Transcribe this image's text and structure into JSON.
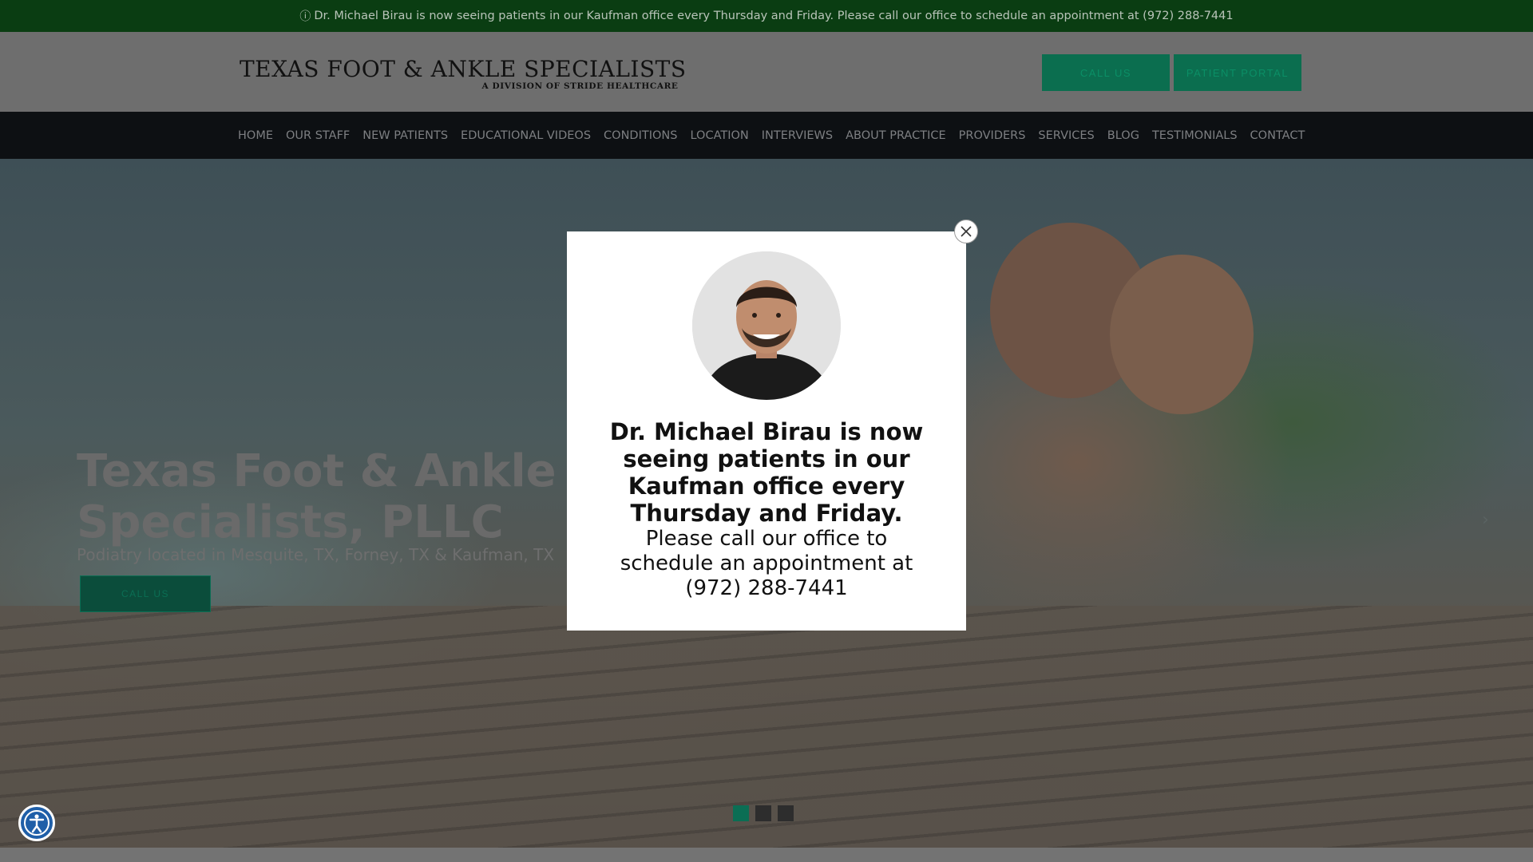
{
  "announcement": {
    "icon": "info-icon",
    "text": "Dr. Michael Birau is now seeing patients in our Kaufman office every Thursday and Friday. Please call our office to schedule an appointment at (972) 288-7441"
  },
  "header": {
    "logo_title": "TEXAS FOOT & ANKLE SPECIALISTS",
    "logo_subtitle": "A DIVISION OF STRIDE HEALTHCARE",
    "call_label": "CALL US",
    "portal_label": "PATIENT PORTAL",
    "accent_color": "#0b6e4f"
  },
  "nav": {
    "items": [
      "HOME",
      "OUR STAFF",
      "NEW PATIENTS",
      "EDUCATIONAL VIDEOS",
      "CONDITIONS",
      "LOCATION",
      "INTERVIEWS",
      "ABOUT PRACTICE",
      "PROVIDERS",
      "SERVICES",
      "BLOG",
      "TESTIMONIALS",
      "CONTACT"
    ]
  },
  "hero": {
    "title": "Texas Foot & Ankle Specialists, PLLC",
    "subtitle": "Podiatry located in Mesquite, TX, Forney, TX & Kaufman, TX",
    "button_label": "CALL US",
    "next_arrow": "›",
    "slides": 3,
    "active_slide": 1
  },
  "modal": {
    "heading": "Dr. Michael Birau is now seeing patients in our Kaufman office every Thursday and Friday.",
    "body": "Please call our office to schedule an appointment at (972) 288-7441",
    "close_icon": "close-icon"
  },
  "accessibility": {
    "icon": "accessibility-icon"
  }
}
